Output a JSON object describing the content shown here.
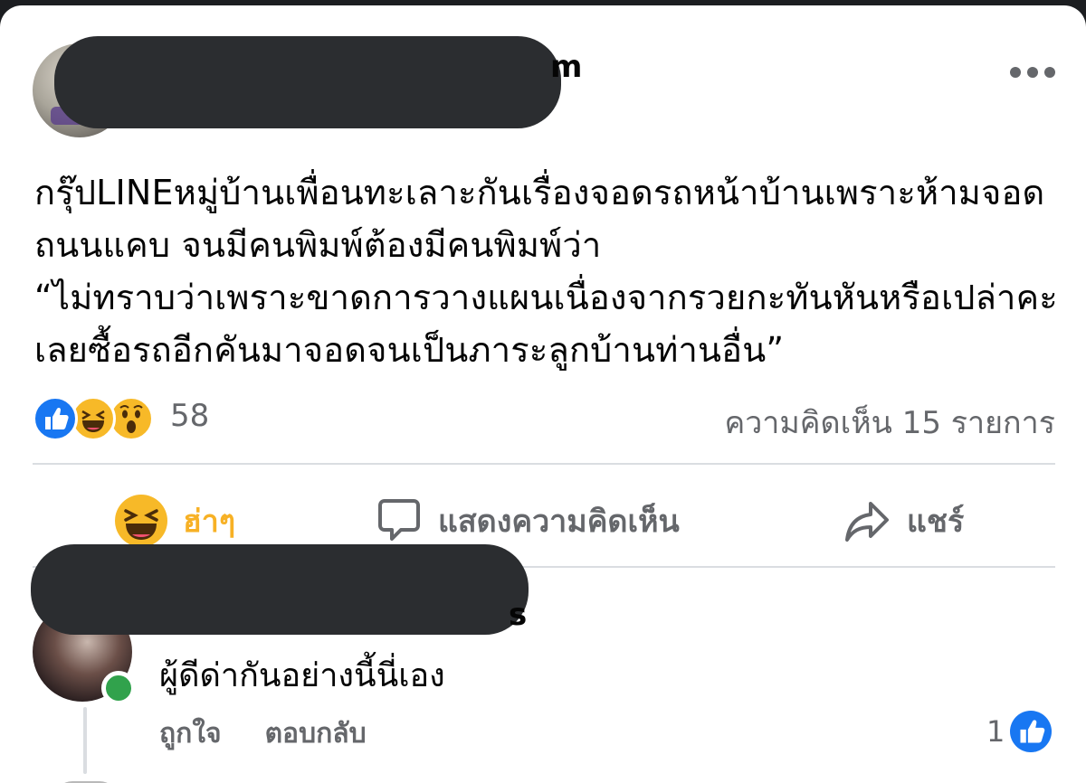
{
  "post": {
    "author_visible_suffix": "m",
    "text_lines": [
      "กรุ๊ปLINEหมู่บ้านเพื่อนทะเลาะกันเรื่องจอดรถหน้าบ้านเพราะห้ามจอด",
      "ถนนแคบ จนมีคนพิมพ์ต้องมีคนพิมพ์ว่า",
      "“ไม่ทราบว่าเพราะขาดการวางแผนเนื่องจากรวยกะทันหันหรือเปล่าคะ",
      "เลยซื้อรถอีกคันมาจอดจนเป็นภาระลูกบ้านท่านอื่น”"
    ],
    "reaction_count": "58",
    "comment_count": "ความคิดเห็น 15 รายการ"
  },
  "actions": {
    "react_label": "ฮ่าๆ",
    "comment_label": "แสดงความคิดเห็น",
    "share_label": "แชร์"
  },
  "comment": {
    "author_visible_suffix": "s",
    "text": "ผู้ดีด่ากันอย่างนี้นี่เอง",
    "like_label": "ถูกใจ",
    "reply_label": "ตอบกลับ",
    "like_count": "1"
  },
  "icons": {
    "like": "like-icon",
    "haha": "haha-icon",
    "wow": "wow-icon",
    "comment": "comment-bubble-icon",
    "share": "share-arrow-icon",
    "more": "more-options-icon"
  },
  "colors": {
    "like_blue": "#1877f2",
    "haha_yellow": "#f7b928",
    "muted_text": "#65676b",
    "online_green": "#31a24c"
  }
}
